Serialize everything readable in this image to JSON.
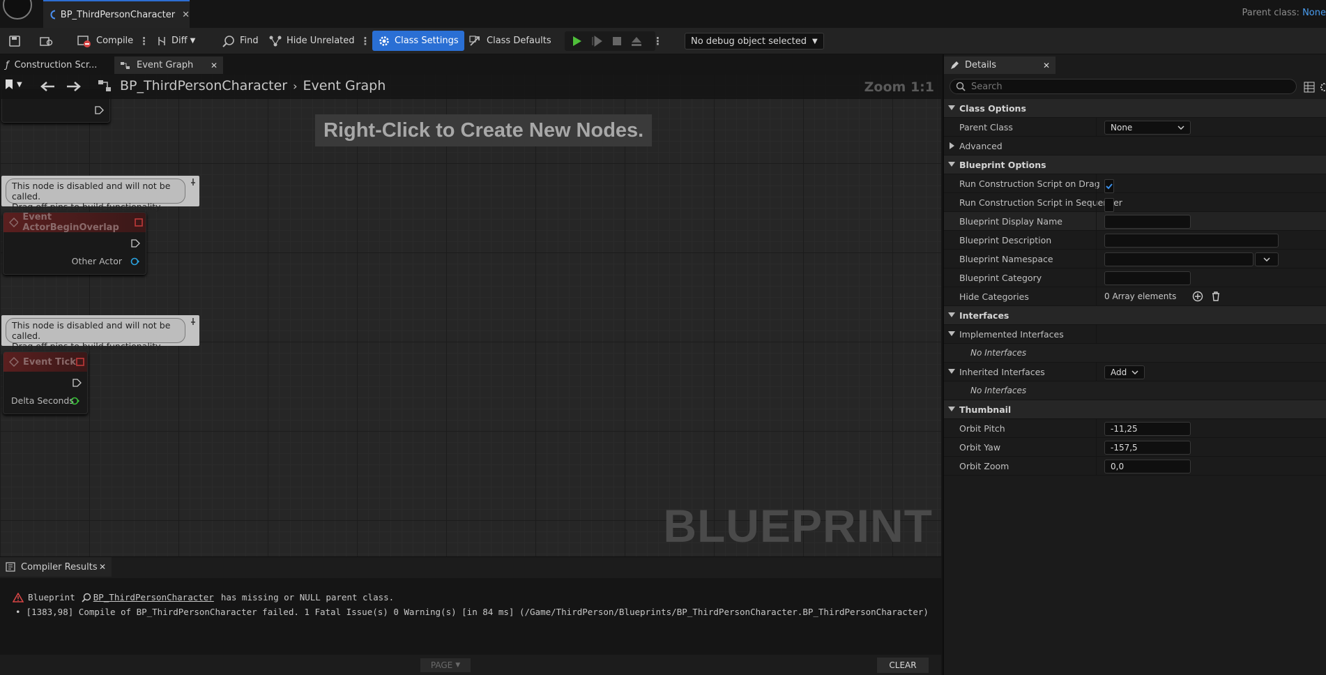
{
  "window": {
    "doc_tab_title": "BP_ThirdPersonCharacter",
    "parent_class_label": "Parent class:",
    "parent_class_value": "None"
  },
  "toolbar": {
    "compile_label": "Compile",
    "diff_label": "Diff",
    "find_label": "Find",
    "hide_unrelated_label": "Hide Unrelated",
    "class_settings_label": "Class Settings",
    "class_defaults_label": "Class Defaults",
    "debug_object_label": "No debug object selected"
  },
  "graph_tabs": [
    {
      "label": "Construction Scr..."
    },
    {
      "label": "Event Graph"
    }
  ],
  "graph": {
    "breadcrumb_root": "BP_ThirdPersonCharacter",
    "breadcrumb_current": "Event Graph",
    "zoom": "Zoom 1:1",
    "hint": "Right-Click to Create New Nodes.",
    "watermark": "BLUEPRINT",
    "comment_line1": "This node is disabled and will not be called.",
    "comment_line2": "Drag off pins to build functionality.",
    "nodes": [
      {
        "title": "Event ActorBeginOverlap",
        "pin": "Other Actor"
      },
      {
        "title": "Event Tick",
        "pin": "Delta Seconds"
      }
    ]
  },
  "compiler": {
    "tab_label": "Compiler Results",
    "line1_prefix": "Blueprint",
    "line1_link": "BP_ThirdPersonCharacter",
    "line1_suffix": "has missing or NULL parent class.",
    "line2": "[1383,98] Compile of BP_ThirdPersonCharacter failed. 1 Fatal Issue(s) 0 Warning(s) [in 84 ms] (/Game/ThirdPerson/Blueprints/BP_ThirdPersonCharacter.BP_ThirdPersonCharacter)",
    "page_label": "PAGE",
    "clear_label": "CLEAR"
  },
  "details": {
    "tab_label": "Details",
    "search_placeholder": "Search",
    "class_options": "Class Options",
    "parent_class": "Parent Class",
    "parent_class_value": "None",
    "advanced": "Advanced",
    "blueprint_options": "Blueprint Options",
    "run_on_drag": "Run Construction Script on Drag",
    "run_on_drag_checked": true,
    "run_in_sequencer": "Run Construction Script in Sequencer",
    "display_name": "Blueprint Display Name",
    "description": "Blueprint Description",
    "namespace": "Blueprint Namespace",
    "category": "Blueprint Category",
    "hide_categories": "Hide Categories",
    "hide_categories_value": "0 Array elements",
    "interfaces": "Interfaces",
    "implemented_interfaces": "Implemented Interfaces",
    "no_interfaces": "No Interfaces",
    "inherited_interfaces": "Inherited Interfaces",
    "add_label": "Add",
    "thumbnail": "Thumbnail",
    "orbit_pitch": "Orbit Pitch",
    "orbit_pitch_value": "-11,25",
    "orbit_yaw": "Orbit Yaw",
    "orbit_yaw_value": "-157,5",
    "orbit_zoom": "Orbit Zoom",
    "orbit_zoom_value": "0,0"
  },
  "colors": {
    "accent": "#2a6fd4",
    "play_green": "#4fbf3a",
    "event_red": "#c03a3a",
    "error_red": "#d64545"
  }
}
